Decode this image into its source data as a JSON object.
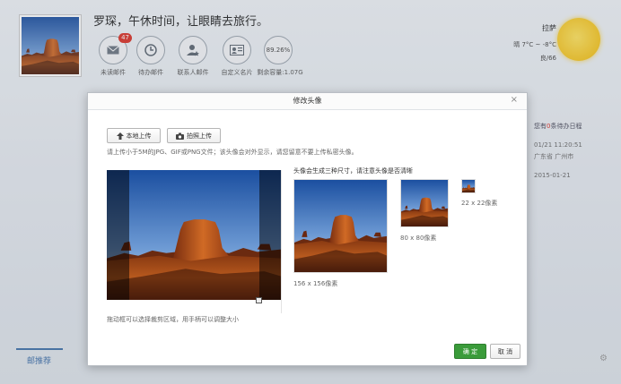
{
  "header": {
    "greeting": "罗琛，午休时间，让眼睛去旅行。",
    "quick_items": [
      {
        "label": "未读邮件",
        "icon": "mail-icon",
        "badge": "47"
      },
      {
        "label": "待办邮件",
        "icon": "clock-icon"
      },
      {
        "label": "联系人邮件",
        "icon": "contact-star-icon"
      },
      {
        "label": "自定义名片",
        "icon": "card-icon"
      },
      {
        "label": "剩余容量:1.07G",
        "icon": "storage-icon",
        "value": "89.26%"
      }
    ]
  },
  "weather": {
    "city": "拉萨",
    "temp": "晴 7°C ~ -8°C",
    "aqi": "良/66"
  },
  "side": {
    "todo_prefix": "您有",
    "todo_count": "0",
    "todo_suffix": "条待办日程",
    "time": "01/21 11:20:51",
    "location": "广东省 广州市",
    "date": "2015-01-21"
  },
  "bottom": {
    "tab_label": "邮推荐"
  },
  "dialog": {
    "title": "修改头像",
    "close": "×",
    "local_upload": "本地上传",
    "photo_upload": "拍照上传",
    "hint": "请上传小于5M的JPG、GIF或PNG文件；该头像会对外显示，请您留意不要上传私密头像。",
    "drag_hint": "拖动框可以选择裁剪区域，用手柄可以调整大小",
    "preview_title": "头像会生成三种尺寸，请注意头像是否清晰",
    "sizes": [
      "156 x 156像素",
      "80 x 80像素",
      "22 x 22像素"
    ],
    "ok": "确 定",
    "cancel": "取 消"
  },
  "colors": {
    "accent_green": "#3a9b3a",
    "badge_red": "#d93025",
    "link_blue": "#3d6fa8"
  }
}
